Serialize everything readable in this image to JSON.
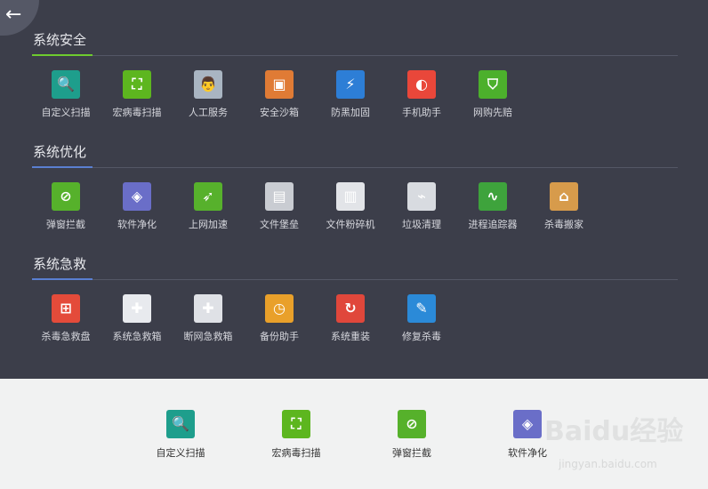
{
  "back_label": "←",
  "sections": [
    {
      "title": "系统安全",
      "accent": "#6ecb2e",
      "items": [
        {
          "label": "自定义扫描",
          "name": "custom-scan",
          "icon": "magnifier-icon",
          "glyph": "🔍",
          "color": "#1e9e8c"
        },
        {
          "label": "宏病毒扫描",
          "name": "macro-virus-scan",
          "icon": "scan-frame-icon",
          "glyph": "⛶",
          "color": "#5db61f"
        },
        {
          "label": "人工服务",
          "name": "manual-service",
          "icon": "doctor-icon",
          "glyph": "👨",
          "color": "#a9b5c2"
        },
        {
          "label": "安全沙箱",
          "name": "safe-sandbox",
          "icon": "sandbox-icon",
          "glyph": "▣",
          "color": "#e07b35"
        },
        {
          "label": "防黑加固",
          "name": "anti-hack",
          "icon": "shield-bolt-icon",
          "glyph": "⚡",
          "color": "#2d7ed6"
        },
        {
          "label": "手机助手",
          "name": "phone-assistant",
          "icon": "phone-ball-icon",
          "glyph": "◐",
          "color": "#e9473a"
        },
        {
          "label": "网购先赔",
          "name": "shopping-compensation",
          "icon": "shield-cart-icon",
          "glyph": "⛉",
          "color": "#4cb02c"
        }
      ]
    },
    {
      "title": "系统优化",
      "accent": "#5a7fd1",
      "items": [
        {
          "label": "弹窗拦截",
          "name": "popup-block",
          "icon": "no-popup-icon",
          "glyph": "⊘",
          "color": "#56b12b"
        },
        {
          "label": "软件净化",
          "name": "software-clean",
          "icon": "layers-icon",
          "glyph": "◈",
          "color": "#6a6ec8"
        },
        {
          "label": "上网加速",
          "name": "network-accelerate",
          "icon": "rocket-icon",
          "glyph": "➶",
          "color": "#57b12c"
        },
        {
          "label": "文件堡垒",
          "name": "file-fortress",
          "icon": "file-lock-icon",
          "glyph": "▤",
          "color": "#c9ccd2"
        },
        {
          "label": "文件粉碎机",
          "name": "file-shredder",
          "icon": "shredder-icon",
          "glyph": "▥",
          "color": "#e2e4e8"
        },
        {
          "label": "垃圾清理",
          "name": "junk-clean",
          "icon": "broom-icon",
          "glyph": "⌁",
          "color": "#d8dbe0"
        },
        {
          "label": "进程追踪器",
          "name": "process-tracker",
          "icon": "pulse-icon",
          "glyph": "∿",
          "color": "#3ea33c"
        },
        {
          "label": "杀毒搬家",
          "name": "antivirus-move",
          "icon": "house-box-icon",
          "glyph": "⌂",
          "color": "#d79b4b"
        }
      ]
    },
    {
      "title": "系统急救",
      "accent": "#5a7fd1",
      "items": [
        {
          "label": "杀毒急救盘",
          "name": "rescue-disk",
          "icon": "usb-icon",
          "glyph": "⊞",
          "color": "#e44b3a"
        },
        {
          "label": "系统急救箱",
          "name": "system-rescue-kit",
          "icon": "first-aid-icon",
          "glyph": "✚",
          "color": "#e8eaee"
        },
        {
          "label": "断网急救箱",
          "name": "network-rescue-kit",
          "icon": "first-aid-drawer-icon",
          "glyph": "✚",
          "color": "#dfe1e6"
        },
        {
          "label": "备份助手",
          "name": "backup-assistant",
          "icon": "backup-clock-icon",
          "glyph": "◷",
          "color": "#e9a02a"
        },
        {
          "label": "系统重装",
          "name": "system-reinstall",
          "icon": "refresh-icon",
          "glyph": "↻",
          "color": "#e0473b"
        },
        {
          "label": "修复杀毒",
          "name": "repair-antivirus",
          "icon": "wrench-shield-icon",
          "glyph": "✎",
          "color": "#2b8ad8"
        }
      ]
    }
  ],
  "bottom_items": [
    {
      "label": "自定义扫描",
      "name": "custom-scan",
      "icon": "magnifier-icon",
      "glyph": "🔍",
      "color": "#1e9e8c"
    },
    {
      "label": "宏病毒扫描",
      "name": "macro-virus-scan",
      "icon": "scan-frame-icon",
      "glyph": "⛶",
      "color": "#5db61f"
    },
    {
      "label": "弹窗拦截",
      "name": "popup-block",
      "icon": "no-popup-icon",
      "glyph": "⊘",
      "color": "#56b12b"
    },
    {
      "label": "软件净化",
      "name": "software-clean",
      "icon": "layers-icon",
      "glyph": "◈",
      "color": "#6a6ec8"
    }
  ],
  "watermark": {
    "logo": "Baidu经验",
    "url": "jingyan.baidu.com"
  }
}
